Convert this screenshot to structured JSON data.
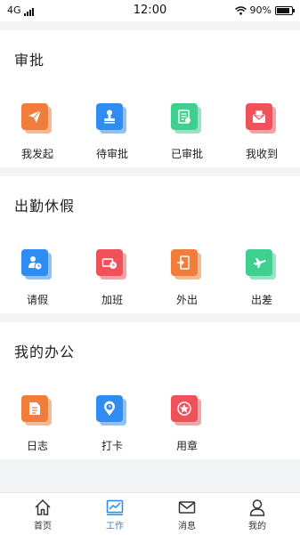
{
  "status_bar": {
    "network": "4G",
    "time": "12:00",
    "battery": "90%"
  },
  "sections": [
    {
      "title": "审批",
      "items": [
        {
          "label": "我发起",
          "icon": "paper-plane-icon",
          "color": "#f07d3c"
        },
        {
          "label": "待审批",
          "icon": "stamp-icon",
          "color": "#2f8cf0"
        },
        {
          "label": "已审批",
          "icon": "approved-document-icon",
          "color": "#3fcf8e"
        },
        {
          "label": "我收到",
          "icon": "envelope-icon",
          "color": "#f0525c"
        }
      ]
    },
    {
      "title": "出勤休假",
      "items": [
        {
          "label": "请假",
          "icon": "user-clock-icon",
          "color": "#2f8cf0"
        },
        {
          "label": "加班",
          "icon": "overtime-clock-icon",
          "color": "#f0525c"
        },
        {
          "label": "外出",
          "icon": "door-exit-icon",
          "color": "#f07d3c"
        },
        {
          "label": "出差",
          "icon": "airplane-icon",
          "color": "#3fcf8e"
        }
      ]
    },
    {
      "title": "我的办公",
      "items": [
        {
          "label": "日志",
          "icon": "log-document-icon",
          "color": "#f07d3c"
        },
        {
          "label": "打卡",
          "icon": "location-clock-icon",
          "color": "#2f8cf0"
        },
        {
          "label": "用章",
          "icon": "seal-star-icon",
          "color": "#f0525c"
        }
      ]
    }
  ],
  "tabbar": {
    "active": "工作",
    "tabs": [
      {
        "label": "首页",
        "icon": "home-icon"
      },
      {
        "label": "工作",
        "icon": "work-chart-icon"
      },
      {
        "label": "消息",
        "icon": "message-envelope-icon"
      },
      {
        "label": "我的",
        "icon": "profile-icon"
      }
    ],
    "active_color": "#1e8cf0"
  }
}
